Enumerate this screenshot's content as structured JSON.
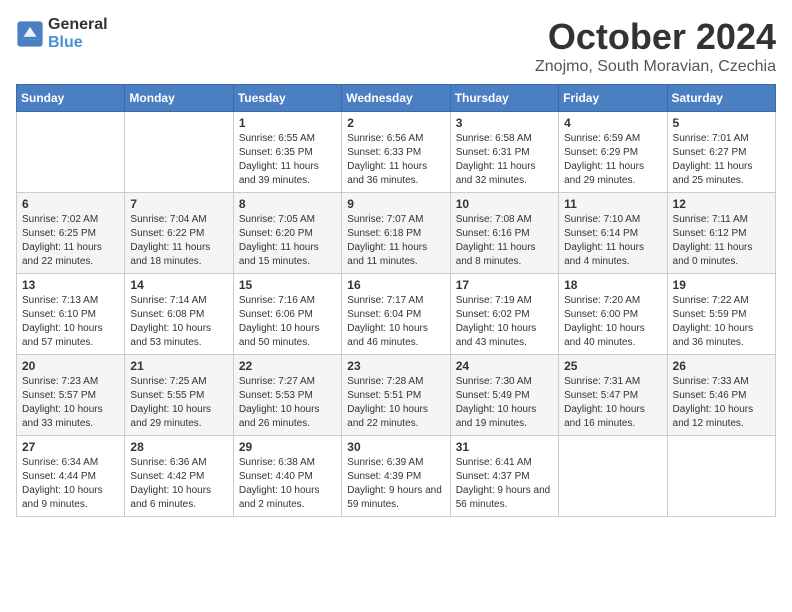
{
  "logo": {
    "general": "General",
    "blue": "Blue"
  },
  "title": "October 2024",
  "location": "Znojmo, South Moravian, Czechia",
  "weekdays": [
    "Sunday",
    "Monday",
    "Tuesday",
    "Wednesday",
    "Thursday",
    "Friday",
    "Saturday"
  ],
  "weeks": [
    [
      {
        "day": "",
        "info": ""
      },
      {
        "day": "",
        "info": ""
      },
      {
        "day": "1",
        "info": "Sunrise: 6:55 AM\nSunset: 6:35 PM\nDaylight: 11 hours and 39 minutes."
      },
      {
        "day": "2",
        "info": "Sunrise: 6:56 AM\nSunset: 6:33 PM\nDaylight: 11 hours and 36 minutes."
      },
      {
        "day": "3",
        "info": "Sunrise: 6:58 AM\nSunset: 6:31 PM\nDaylight: 11 hours and 32 minutes."
      },
      {
        "day": "4",
        "info": "Sunrise: 6:59 AM\nSunset: 6:29 PM\nDaylight: 11 hours and 29 minutes."
      },
      {
        "day": "5",
        "info": "Sunrise: 7:01 AM\nSunset: 6:27 PM\nDaylight: 11 hours and 25 minutes."
      }
    ],
    [
      {
        "day": "6",
        "info": "Sunrise: 7:02 AM\nSunset: 6:25 PM\nDaylight: 11 hours and 22 minutes."
      },
      {
        "day": "7",
        "info": "Sunrise: 7:04 AM\nSunset: 6:22 PM\nDaylight: 11 hours and 18 minutes."
      },
      {
        "day": "8",
        "info": "Sunrise: 7:05 AM\nSunset: 6:20 PM\nDaylight: 11 hours and 15 minutes."
      },
      {
        "day": "9",
        "info": "Sunrise: 7:07 AM\nSunset: 6:18 PM\nDaylight: 11 hours and 11 minutes."
      },
      {
        "day": "10",
        "info": "Sunrise: 7:08 AM\nSunset: 6:16 PM\nDaylight: 11 hours and 8 minutes."
      },
      {
        "day": "11",
        "info": "Sunrise: 7:10 AM\nSunset: 6:14 PM\nDaylight: 11 hours and 4 minutes."
      },
      {
        "day": "12",
        "info": "Sunrise: 7:11 AM\nSunset: 6:12 PM\nDaylight: 11 hours and 0 minutes."
      }
    ],
    [
      {
        "day": "13",
        "info": "Sunrise: 7:13 AM\nSunset: 6:10 PM\nDaylight: 10 hours and 57 minutes."
      },
      {
        "day": "14",
        "info": "Sunrise: 7:14 AM\nSunset: 6:08 PM\nDaylight: 10 hours and 53 minutes."
      },
      {
        "day": "15",
        "info": "Sunrise: 7:16 AM\nSunset: 6:06 PM\nDaylight: 10 hours and 50 minutes."
      },
      {
        "day": "16",
        "info": "Sunrise: 7:17 AM\nSunset: 6:04 PM\nDaylight: 10 hours and 46 minutes."
      },
      {
        "day": "17",
        "info": "Sunrise: 7:19 AM\nSunset: 6:02 PM\nDaylight: 10 hours and 43 minutes."
      },
      {
        "day": "18",
        "info": "Sunrise: 7:20 AM\nSunset: 6:00 PM\nDaylight: 10 hours and 40 minutes."
      },
      {
        "day": "19",
        "info": "Sunrise: 7:22 AM\nSunset: 5:59 PM\nDaylight: 10 hours and 36 minutes."
      }
    ],
    [
      {
        "day": "20",
        "info": "Sunrise: 7:23 AM\nSunset: 5:57 PM\nDaylight: 10 hours and 33 minutes."
      },
      {
        "day": "21",
        "info": "Sunrise: 7:25 AM\nSunset: 5:55 PM\nDaylight: 10 hours and 29 minutes."
      },
      {
        "day": "22",
        "info": "Sunrise: 7:27 AM\nSunset: 5:53 PM\nDaylight: 10 hours and 26 minutes."
      },
      {
        "day": "23",
        "info": "Sunrise: 7:28 AM\nSunset: 5:51 PM\nDaylight: 10 hours and 22 minutes."
      },
      {
        "day": "24",
        "info": "Sunrise: 7:30 AM\nSunset: 5:49 PM\nDaylight: 10 hours and 19 minutes."
      },
      {
        "day": "25",
        "info": "Sunrise: 7:31 AM\nSunset: 5:47 PM\nDaylight: 10 hours and 16 minutes."
      },
      {
        "day": "26",
        "info": "Sunrise: 7:33 AM\nSunset: 5:46 PM\nDaylight: 10 hours and 12 minutes."
      }
    ],
    [
      {
        "day": "27",
        "info": "Sunrise: 6:34 AM\nSunset: 4:44 PM\nDaylight: 10 hours and 9 minutes."
      },
      {
        "day": "28",
        "info": "Sunrise: 6:36 AM\nSunset: 4:42 PM\nDaylight: 10 hours and 6 minutes."
      },
      {
        "day": "29",
        "info": "Sunrise: 6:38 AM\nSunset: 4:40 PM\nDaylight: 10 hours and 2 minutes."
      },
      {
        "day": "30",
        "info": "Sunrise: 6:39 AM\nSunset: 4:39 PM\nDaylight: 9 hours and 59 minutes."
      },
      {
        "day": "31",
        "info": "Sunrise: 6:41 AM\nSunset: 4:37 PM\nDaylight: 9 hours and 56 minutes."
      },
      {
        "day": "",
        "info": ""
      },
      {
        "day": "",
        "info": ""
      }
    ]
  ]
}
